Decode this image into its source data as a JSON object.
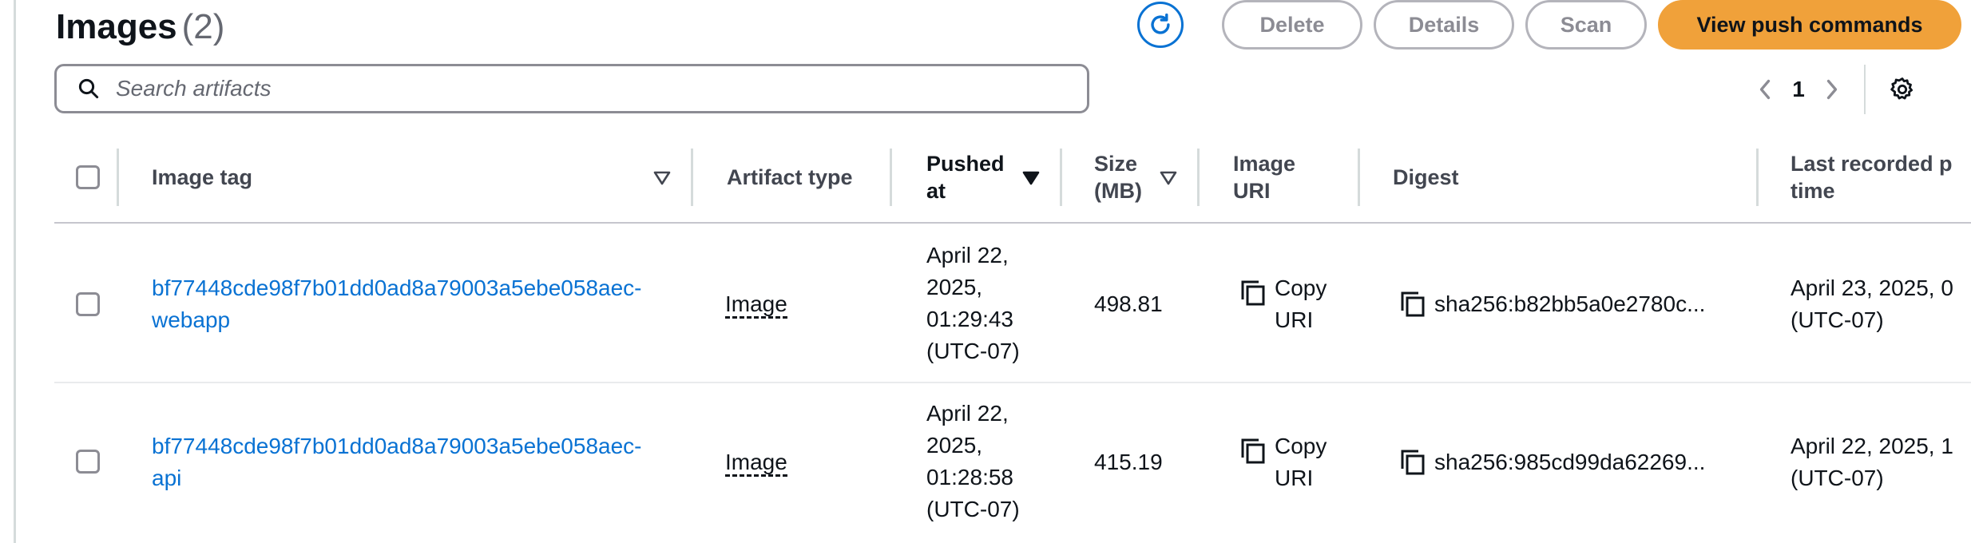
{
  "header": {
    "title": "Images",
    "count": "(2)"
  },
  "actions": {
    "delete_label": "Delete",
    "details_label": "Details",
    "scan_label": "Scan",
    "push_label": "View push commands"
  },
  "search": {
    "placeholder": "Search artifacts",
    "value": ""
  },
  "pagination": {
    "current_page": "1"
  },
  "table": {
    "columns": {
      "image_tag": "Image tag",
      "artifact_type": "Artifact type",
      "pushed_at_line1": "Pushed",
      "pushed_at_line2": "at",
      "size_line1": "Size",
      "size_line2": "(MB)",
      "uri_line1": "Image",
      "uri_line2": "URI",
      "digest": "Digest",
      "last_recorded_line1": "Last recorded p",
      "last_recorded_line2": "time"
    },
    "rows": [
      {
        "tag_line1": "bf77448cde98f7b01dd0ad8a79003a5ebe058aec-",
        "tag_line2": "webapp",
        "artifact_type": "Image",
        "pushed_l1": "April 22,",
        "pushed_l2": "2025,",
        "pushed_l3": "01:29:43",
        "pushed_l4": "(UTC-07)",
        "size": "498.81",
        "copy_l1": "Copy",
        "copy_l2": "URI",
        "digest": "sha256:b82bb5a0e2780c...",
        "last_l1": "April 23, 2025, 0",
        "last_l2": "(UTC-07)"
      },
      {
        "tag_line1": "bf77448cde98f7b01dd0ad8a79003a5ebe058aec-",
        "tag_line2": "api",
        "artifact_type": "Image",
        "pushed_l1": "April 22,",
        "pushed_l2": "2025,",
        "pushed_l3": "01:28:58",
        "pushed_l4": "(UTC-07)",
        "size": "415.19",
        "copy_l1": "Copy",
        "copy_l2": "URI",
        "digest": "sha256:985cd99da62269...",
        "last_l1": "April 22, 2025, 1",
        "last_l2": "(UTC-07)"
      }
    ]
  },
  "colors": {
    "accent": "#0972d3",
    "primary_button": "#f0a13a",
    "disabled_text": "#8c8c94",
    "divider": "#d5dbdb"
  },
  "icons": [
    "refresh-icon",
    "search-icon",
    "chevron-left-icon",
    "chevron-right-icon",
    "gear-icon",
    "sort-icon",
    "copy-icon"
  ]
}
